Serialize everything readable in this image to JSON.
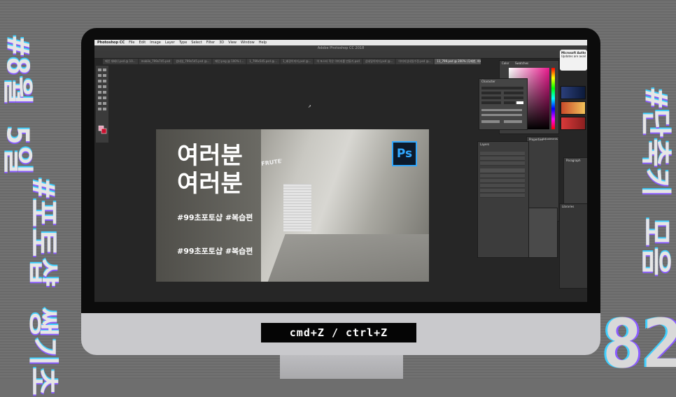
{
  "overlay": {
    "side_left_top": "#8월 5일",
    "side_left_bottom": "#포토샵 쌩기초",
    "side_right": "#단축키 모음",
    "big_number": "82",
    "caption": "cmd+Z / ctrl+Z"
  },
  "app": {
    "menu": [
      "Photoshop CC",
      "File",
      "Edit",
      "Image",
      "Layer",
      "Type",
      "Select",
      "Filter",
      "3D",
      "View",
      "Window",
      "Help"
    ],
    "window_title": "Adobe Photoshop CC 2018",
    "tabs": [
      {
        "label": "메인 대배너.psd @ 10...",
        "active": false
      },
      {
        "label": "mobile_799x745.psd",
        "active": false
      },
      {
        "label": "썸네일_799x545.psd @...",
        "active": false
      },
      {
        "label": "메인.png @ 100% (...",
        "active": false
      },
      {
        "label": "1_799x545.psd @...",
        "active": false
      },
      {
        "label": "1_배경이미지.psd @...",
        "active": false
      },
      {
        "label": "이 포스터 작은 이미지를 만들기.psd",
        "active": false
      },
      {
        "label": "섬네일이미지.psd @...",
        "active": false
      },
      {
        "label": "이미지섬네일수정.psd @...",
        "active": false
      },
      {
        "label": "11_799.psd @ 200% (무제한, 여러분홍...)",
        "active": true
      }
    ]
  },
  "canvas": {
    "headline": [
      "여러분",
      "여러분"
    ],
    "tag1": "#99초포토샵 #복습편",
    "tag2": "#99초포토샵 #복습편",
    "logo": "Ps",
    "sign": "FRUTERIA"
  },
  "panels": {
    "color": "Color",
    "swatches": "Swatches",
    "character": "Character",
    "layers": "Layers",
    "properties": "Properties",
    "adjustments": "Adjustments",
    "paragraph": "Paragraph",
    "libraries": "Libraries",
    "notification_title": "Microsoft Authenticator",
    "notification_body": "Updates are available"
  },
  "colors": {
    "ps_blue": "#31a8ff",
    "accent_pink": "#e9198d"
  }
}
